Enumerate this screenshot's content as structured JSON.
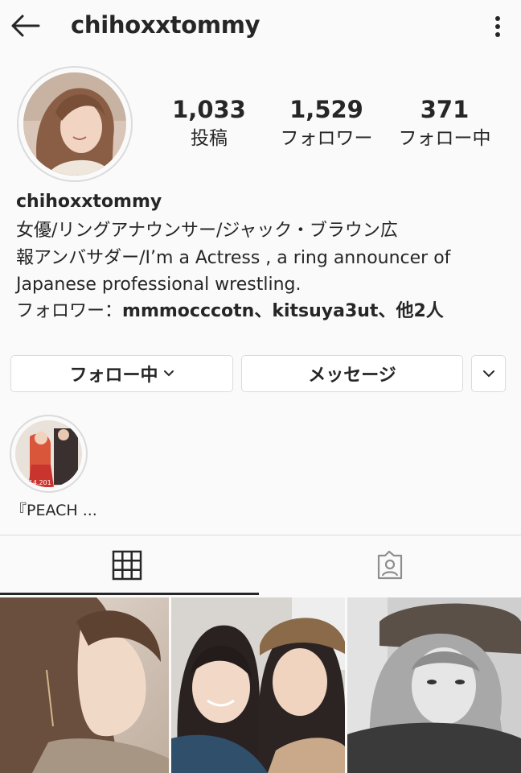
{
  "header": {
    "username": "chihoxxtommy",
    "back_icon": "arrow-left-icon",
    "more_icon": "vertical-dots-icon"
  },
  "profile": {
    "username": "chihoxxtommy",
    "stats": {
      "posts": {
        "value": "1,033",
        "label": "投稿"
      },
      "followers": {
        "value": "1,529",
        "label": "フォロワー"
      },
      "following": {
        "value": "371",
        "label": "フォロー中"
      }
    },
    "bio": "女優/リングアナウンサー/ジャック・ブラウン広\n報アンバサダー/I’m a Actress , a ring announcer of\nJapanese professional wrestling.",
    "followed_by": {
      "prefix": "フォロワー：",
      "names": "mmmocccotn、kitsuya3ut",
      "suffix": "、他2人"
    }
  },
  "buttons": {
    "following_label": "フォロー中",
    "message_label": "メッセージ"
  },
  "highlight": {
    "label": "『PEACH ...",
    "date_text": "10.14.201"
  },
  "tabs": {
    "grid_icon": "grid-icon",
    "tagged_icon": "tagged-person-icon"
  },
  "colors": {
    "background": "#fafafa",
    "text": "#262626",
    "border": "#dbdbdb"
  }
}
